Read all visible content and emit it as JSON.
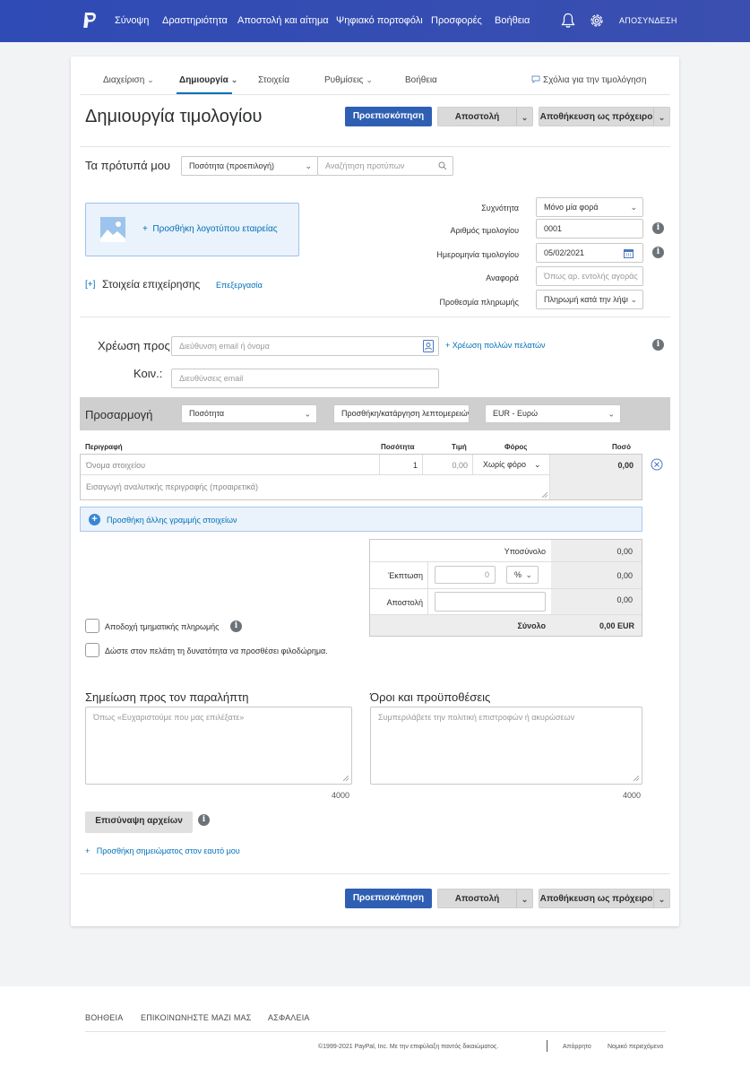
{
  "colors": {
    "nav_bg": "#2f4bb5",
    "primary": "#2f5fb3",
    "link": "#0070ba",
    "logo_box_bg": "#eaf2fb"
  },
  "topnav": {
    "links": [
      "Σύνοψη",
      "Δραστηριότητα",
      "Αποστολή και αίτημα",
      "Ψηφιακό πορτοφόλι",
      "Προσφορές",
      "Βοήθεια"
    ],
    "logout": "ΑΠΟΣΥΝΔΕΣΗ"
  },
  "subnav": {
    "tabs": [
      "Διαχείριση",
      "Δημιουργία",
      "Στοιχεία",
      "Ρυθμίσεις",
      "Βοήθεια"
    ],
    "feedback": "Σχόλια για την τιμολόγηση"
  },
  "header": {
    "title": "Δημιουργία τιμολογίου",
    "preview": "Προεπισκόπηση",
    "send": "Αποστολή",
    "save_draft": "Αποθήκευση ως πρόχειρο"
  },
  "templates": {
    "label": "Τα πρότυπά μου",
    "selected": "Ποσότητα (προεπιλογή)",
    "search_placeholder": "Αναζήτηση προτύπων"
  },
  "logo": {
    "add_label": "Προσθήκη λογοτύπου εταιρείας"
  },
  "business": {
    "toggle": "[+]",
    "label": "Στοιχεία επιχείρησης",
    "edit": "Επεξεργασία"
  },
  "meta": {
    "frequency_label": "Συχνότητα",
    "frequency_value": "Μόνο μία φορά",
    "number_label": "Αριθμός τιμολογίου",
    "number_value": "0001",
    "date_label": "Ημερομηνία τιμολογίου",
    "date_value": "05/02/2021",
    "reference_label": "Αναφορά",
    "reference_placeholder": "Όπως αρ. εντολής αγοράς",
    "due_label": "Προθεσμία πληρωμής",
    "due_value": "Πληρωμή κατά την λήψη"
  },
  "bill_to": {
    "label": "Χρέωση προς:",
    "placeholder": "Διεύθυνση email ή όνομα",
    "multi": "+ Χρέωση πολλών πελατών",
    "cc_label": "Κοιν.:",
    "cc_placeholder": "Διευθύνσεις email"
  },
  "customize": {
    "label": "Προσαρμογή",
    "qty_select": "Ποσότητα",
    "details_btn": "Προσθήκη/κατάργηση λεπτομερειών",
    "currency": "EUR - Ευρώ"
  },
  "table": {
    "headers": [
      "Περιγραφή",
      "Ποσότητα",
      "Τιμή",
      "Φόρος",
      "Ποσό"
    ],
    "item_placeholder": "Όνομα στοιχείου",
    "qty": "1",
    "price": "0,00",
    "tax": "Χωρίς φόρο",
    "amount": "0,00",
    "desc_placeholder": "Εισαγωγή αναλυτικής περιγραφής (προαιρετικά)",
    "add_line": "Προσθήκη άλλης γραμμής στοιχείων"
  },
  "totals": {
    "subtotal_label": "Υποσύνολο",
    "subtotal": "0,00",
    "discount_label": "Έκπτωση",
    "discount_input": "0",
    "discount_unit": "%",
    "discount": "0,00",
    "shipping_label": "Αποστολή",
    "shipping": "0,00",
    "total_label": "Σύνολο",
    "total": "0,00 EUR"
  },
  "options": {
    "partial": "Αποδοχή τμηματικής πληρωμής",
    "tip": "Δώστε στον πελάτη τη δυνατότητα να προσθέσει φιλοδώρημα."
  },
  "notes": {
    "note_label": "Σημείωση προς τον παραλήπτη",
    "note_placeholder": "Όπως «Ευχαριστούμε που μας επιλέξατε»",
    "terms_label": "Όροι και προϋποθέσεις",
    "terms_placeholder": "Συμπεριλάβετε την πολιτική επιστροφών ή ακυρώσεων",
    "note_limit": "4000",
    "terms_limit": "4000"
  },
  "attach": {
    "label": "Επισύναψη αρχείων",
    "memo": "Προσθήκη σημειώματος στον εαυτό μου"
  },
  "footer": {
    "links": [
      "ΒΟΗΘΕΙΑ",
      "ΕΠΙΚΟΙΝΩΝΗΣΤΕ ΜΑΖΙ ΜΑΣ",
      "ΑΣΦΑΛΕΙΑ"
    ],
    "copyright": "©1999-2021 PayPal, Inc. Με την επιφύλαξη παντός δικαιώματος.",
    "privacy": "Απόρρητο",
    "legal": "Νομικό περιεχόμενο"
  }
}
